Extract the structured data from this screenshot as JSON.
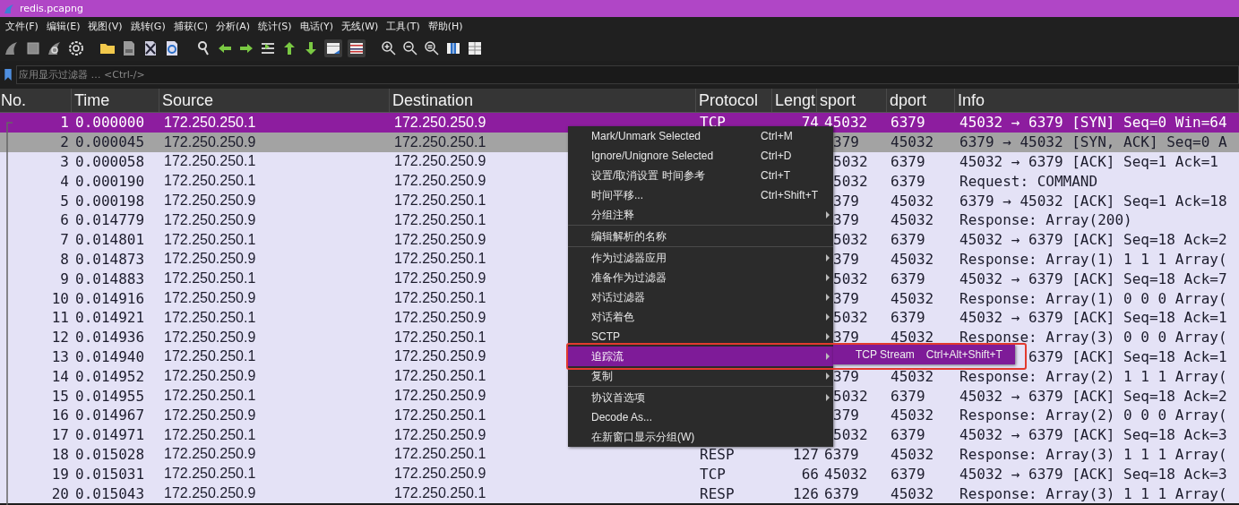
{
  "window": {
    "title": "redis.pcapng"
  },
  "menu_bar": [
    "文件(F)",
    "编辑(E)",
    "视图(V)",
    "跳转(G)",
    "捕获(C)",
    "分析(A)",
    "统计(S)",
    "电话(Y)",
    "无线(W)",
    "工具(T)",
    "帮助(H)"
  ],
  "filter": {
    "placeholder": "应用显示过滤器 … <Ctrl-/>"
  },
  "table": {
    "columns": [
      "No.",
      "Time",
      "Source",
      "Destination",
      "Protocol",
      "Lengt",
      "sport",
      "dport",
      "Info"
    ],
    "rows": [
      {
        "kind": "full",
        "selected": true,
        "hover": false,
        "no": "1",
        "time": "0.000000",
        "source": "172.250.250.1",
        "destination": "172.250.250.9",
        "protocol": "TCP",
        "length": "74",
        "sport": "45032",
        "dport": "6379",
        "info": "45032 → 6379 [SYN] Seq=0 Win=64"
      },
      {
        "kind": "menu",
        "selected": false,
        "hover": true,
        "no": "2",
        "time": "0.000045",
        "source": "172.250.250.9",
        "destination": "172.250.250.1",
        "sport": "379",
        "dport": "45032",
        "info": "6379 → 45032 [SYN, ACK] Seq=0 A"
      },
      {
        "kind": "menu",
        "selected": false,
        "hover": false,
        "no": "3",
        "time": "0.000058",
        "source": "172.250.250.1",
        "destination": "172.250.250.9",
        "sport": "5032",
        "dport": "6379",
        "info": "45032 → 6379 [ACK] Seq=1 Ack=1"
      },
      {
        "kind": "menu",
        "selected": false,
        "hover": false,
        "no": "4",
        "time": "0.000190",
        "source": "172.250.250.1",
        "destination": "172.250.250.9",
        "sport": "5032",
        "dport": "6379",
        "info": "Request: COMMAND"
      },
      {
        "kind": "menu",
        "selected": false,
        "hover": false,
        "no": "5",
        "time": "0.000198",
        "source": "172.250.250.9",
        "destination": "172.250.250.1",
        "sport": "379",
        "dport": "45032",
        "info": "6379 → 45032 [ACK] Seq=1 Ack=18"
      },
      {
        "kind": "menu",
        "selected": false,
        "hover": false,
        "no": "6",
        "time": "0.014779",
        "source": "172.250.250.9",
        "destination": "172.250.250.1",
        "sport": "379",
        "dport": "45032",
        "info": "Response: Array(200)"
      },
      {
        "kind": "menu",
        "selected": false,
        "hover": false,
        "no": "7",
        "time": "0.014801",
        "source": "172.250.250.1",
        "destination": "172.250.250.9",
        "sport": "5032",
        "dport": "6379",
        "info": "45032 → 6379 [ACK] Seq=18 Ack=2"
      },
      {
        "kind": "menu",
        "selected": false,
        "hover": false,
        "no": "8",
        "time": "0.014873",
        "source": "172.250.250.9",
        "destination": "172.250.250.1",
        "sport": "379",
        "dport": "45032",
        "info": "Response: Array(1) 1 1 1 Array("
      },
      {
        "kind": "menu",
        "selected": false,
        "hover": false,
        "no": "9",
        "time": "0.014883",
        "source": "172.250.250.1",
        "destination": "172.250.250.9",
        "sport": "5032",
        "dport": "6379",
        "info": "45032 → 6379 [ACK] Seq=18 Ack=7"
      },
      {
        "kind": "menu",
        "selected": false,
        "hover": false,
        "no": "10",
        "time": "0.014916",
        "source": "172.250.250.9",
        "destination": "172.250.250.1",
        "sport": "379",
        "dport": "45032",
        "info": "Response: Array(1) 0 0 0 Array("
      },
      {
        "kind": "menu",
        "selected": false,
        "hover": false,
        "no": "11",
        "time": "0.014921",
        "source": "172.250.250.1",
        "destination": "172.250.250.9",
        "sport": "5032",
        "dport": "6379",
        "info": "45032 → 6379 [ACK] Seq=18 Ack=1"
      },
      {
        "kind": "menu",
        "selected": false,
        "hover": false,
        "no": "12",
        "time": "0.014936",
        "source": "172.250.250.9",
        "destination": "172.250.250.1",
        "sport": "379",
        "dport": "45032",
        "info": "Response: Array(3) 0 0 0 Array("
      },
      {
        "kind": "submenu",
        "selected": false,
        "hover": false,
        "no": "13",
        "time": "0.014940",
        "source": "172.250.250.1",
        "destination": "172.250.250.9",
        "info": "6379 [ACK] Seq=18 Ack=1"
      },
      {
        "kind": "menu",
        "selected": false,
        "hover": false,
        "no": "14",
        "time": "0.014952",
        "source": "172.250.250.9",
        "destination": "172.250.250.1",
        "sport": "379",
        "dport": "45032",
        "info": "Response: Array(2) 1 1 1 Array("
      },
      {
        "kind": "menu",
        "selected": false,
        "hover": false,
        "no": "15",
        "time": "0.014955",
        "source": "172.250.250.1",
        "destination": "172.250.250.9",
        "sport": "5032",
        "dport": "6379",
        "info": "45032 → 6379 [ACK] Seq=18 Ack=2"
      },
      {
        "kind": "menu",
        "selected": false,
        "hover": false,
        "no": "16",
        "time": "0.014967",
        "source": "172.250.250.9",
        "destination": "172.250.250.1",
        "sport": "379",
        "dport": "45032",
        "info": "Response: Array(2) 0 0 0 Array("
      },
      {
        "kind": "menu",
        "selected": false,
        "hover": false,
        "no": "17",
        "time": "0.014971",
        "source": "172.250.250.1",
        "destination": "172.250.250.9",
        "sport": "5032",
        "dport": "6379",
        "info": "45032 → 6379 [ACK] Seq=18 Ack=3"
      },
      {
        "kind": "full",
        "selected": false,
        "hover": false,
        "no": "18",
        "time": "0.015028",
        "source": "172.250.250.9",
        "destination": "172.250.250.1",
        "protocol": "RESP",
        "length": "127",
        "sport": "6379",
        "dport": "45032",
        "info": "Response: Array(3) 1 1 1 Array("
      },
      {
        "kind": "full",
        "selected": false,
        "hover": false,
        "no": "19",
        "time": "0.015031",
        "source": "172.250.250.1",
        "destination": "172.250.250.9",
        "protocol": "TCP",
        "length": "66",
        "sport": "45032",
        "dport": "6379",
        "info": "45032 → 6379 [ACK] Seq=18 Ack=3"
      },
      {
        "kind": "full",
        "selected": false,
        "hover": false,
        "no": "20",
        "time": "0.015043",
        "source": "172.250.250.9",
        "destination": "172.250.250.1",
        "protocol": "RESP",
        "length": "126",
        "sport": "6379",
        "dport": "45032",
        "info": "Response: Array(3) 1 1 1 Array("
      }
    ]
  },
  "context_menu": {
    "items": [
      {
        "label": "Mark/Unmark Selected",
        "shortcut": "Ctrl+M",
        "submenu": false,
        "selected": false,
        "divider": false,
        "outlined": false
      },
      {
        "label": "Ignore/Unignore Selected",
        "shortcut": "Ctrl+D",
        "submenu": false,
        "selected": false,
        "divider": false,
        "outlined": false
      },
      {
        "label": "设置/取消设置 时间参考",
        "shortcut": "Ctrl+T",
        "submenu": false,
        "selected": false,
        "divider": false,
        "outlined": false
      },
      {
        "label": "时间平移...",
        "shortcut": "Ctrl+Shift+T",
        "submenu": false,
        "selected": false,
        "divider": false,
        "outlined": false
      },
      {
        "label": "分组注释",
        "submenu": true,
        "selected": false,
        "divider": true,
        "outlined": false
      },
      {
        "label": "编辑解析的名称",
        "submenu": false,
        "selected": false,
        "divider": true,
        "outlined": false
      },
      {
        "label": "作为过滤器应用",
        "submenu": true,
        "selected": false,
        "divider": false,
        "outlined": false
      },
      {
        "label": "准备作为过滤器",
        "submenu": true,
        "selected": false,
        "divider": false,
        "outlined": false
      },
      {
        "label": "对话过滤器",
        "submenu": true,
        "selected": false,
        "divider": false,
        "outlined": false
      },
      {
        "label": "对话着色",
        "submenu": true,
        "selected": false,
        "divider": false,
        "outlined": false
      },
      {
        "label": "SCTP",
        "submenu": true,
        "selected": false,
        "divider": false,
        "outlined": false
      },
      {
        "label": "追踪流",
        "submenu": true,
        "selected": true,
        "divider": false,
        "outlined": true
      },
      {
        "label": "复制",
        "submenu": true,
        "selected": false,
        "divider": true,
        "outlined": false
      },
      {
        "label": "协议首选项",
        "submenu": true,
        "selected": false,
        "divider": false,
        "outlined": false
      },
      {
        "label": "Decode As...",
        "submenu": false,
        "selected": false,
        "divider": false,
        "outlined": false
      },
      {
        "label": "在新窗口显示分组(W)",
        "submenu": false,
        "selected": false,
        "divider": false,
        "outlined": false
      }
    ]
  },
  "submenu": {
    "items": [
      {
        "label": "TCP Stream",
        "shortcut": "Ctrl+Alt+Shift+T",
        "selected": true
      }
    ]
  }
}
